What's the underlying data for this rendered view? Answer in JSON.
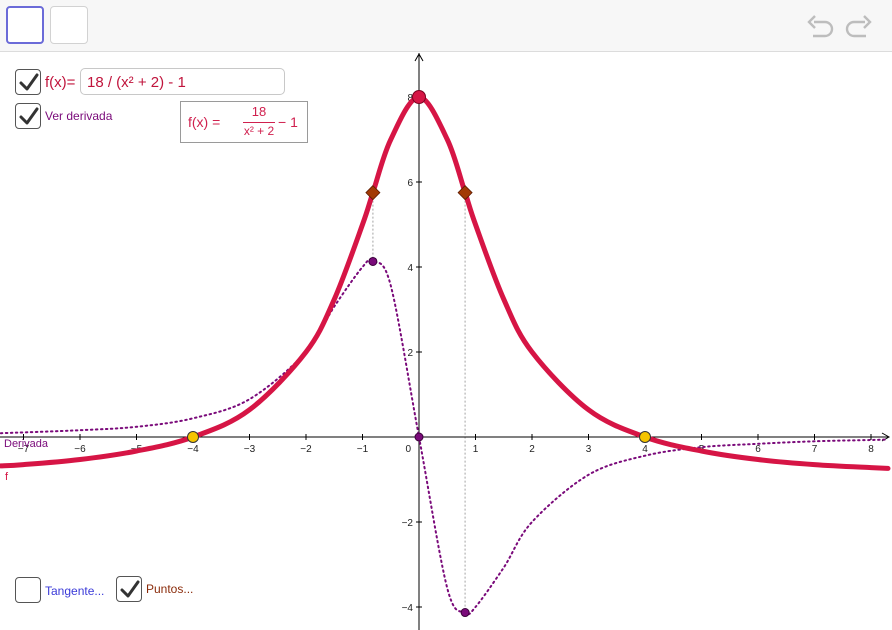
{
  "colors": {
    "f": "#d61545",
    "derivative": "#7a0a7a",
    "root_point": "#f5c400",
    "diamond": "#a23a05",
    "axis": "#000000",
    "guide": "#b8b8b8"
  },
  "icons": {
    "undo": "undo-arrow-icon",
    "redo": "redo-arrow-icon",
    "checkmark": "checkmark-icon"
  },
  "function_input": {
    "label": "f(x)=",
    "value": "18 / (x² + 2) - 1",
    "checked": true
  },
  "formula": {
    "lhs": "f(x) =",
    "numerator": "18",
    "denominator": "x² + 2",
    "tail": "− 1"
  },
  "checkboxes": {
    "ver_derivada": {
      "label": "Ver derivada",
      "checked": true
    },
    "tangente": {
      "label": "Tangente...",
      "checked": false
    },
    "puntos": {
      "label": "Puntos...",
      "checked": true
    }
  },
  "curve_labels": {
    "derivative": "Derivada",
    "f": "f"
  },
  "chart_data": {
    "type": "line",
    "xlim": [
      -7.4,
      8.3
    ],
    "ylim": [
      -4.5,
      8.5
    ],
    "x_ticks": [
      "−7",
      "−6",
      "−5",
      "−4",
      "−3",
      "−2",
      "−1",
      "1",
      "2",
      "3",
      "4",
      "5",
      "6",
      "7",
      "8"
    ],
    "x_tick_values": [
      -7,
      -6,
      -5,
      -4,
      -3,
      -2,
      -1,
      1,
      2,
      3,
      4,
      5,
      6,
      7,
      8
    ],
    "y_ticks": [
      "−4",
      "−2",
      "2",
      "4",
      "6",
      "8"
    ],
    "y_tick_values": [
      -4,
      -2,
      2,
      4,
      6,
      8
    ],
    "origin_label": "0",
    "series": [
      {
        "x": [
          -7.4,
          -7,
          -6,
          -5,
          -4,
          -3,
          -2,
          -1.5,
          -1,
          -0.816,
          -0.5,
          0,
          0.5,
          0.816,
          1,
          1.5,
          2,
          3,
          4,
          5,
          6,
          7,
          8,
          8.3
        ],
        "y": [
          -0.68,
          -0.65,
          -0.53,
          -0.33,
          0,
          0.64,
          2,
          3.24,
          5,
          5.75,
          7,
          8,
          7,
          5.75,
          5,
          3.24,
          2,
          0.64,
          0,
          -0.33,
          -0.53,
          -0.65,
          -0.72,
          -0.74
        ]
      },
      {
        "x": [
          -7.4,
          -6,
          -5,
          -4,
          -3,
          -2,
          -1.5,
          -1,
          -0.816,
          -0.5,
          0,
          0.5,
          0.816,
          1,
          1.5,
          2,
          3,
          4,
          5,
          6,
          7,
          8,
          8.3
        ],
        "y": [
          0.09,
          0.16,
          0.24,
          0.44,
          0.89,
          2,
          3.07,
          4,
          4.13,
          3.56,
          0,
          -3.56,
          -4.13,
          -4,
          -3.07,
          -2,
          -0.89,
          -0.44,
          -0.24,
          -0.16,
          -0.1,
          -0.07,
          -0.06
        ]
      }
    ],
    "points": {
      "roots": [
        [
          -4,
          0
        ],
        [
          4,
          0
        ]
      ],
      "maximum": [
        0,
        8
      ],
      "inflection": [
        [
          -0.816,
          5.75
        ],
        [
          0.816,
          5.75
        ]
      ],
      "derivative_extrema": [
        [
          -0.816,
          4.13
        ],
        [
          0,
          0
        ],
        [
          0.816,
          -4.13
        ]
      ]
    }
  }
}
